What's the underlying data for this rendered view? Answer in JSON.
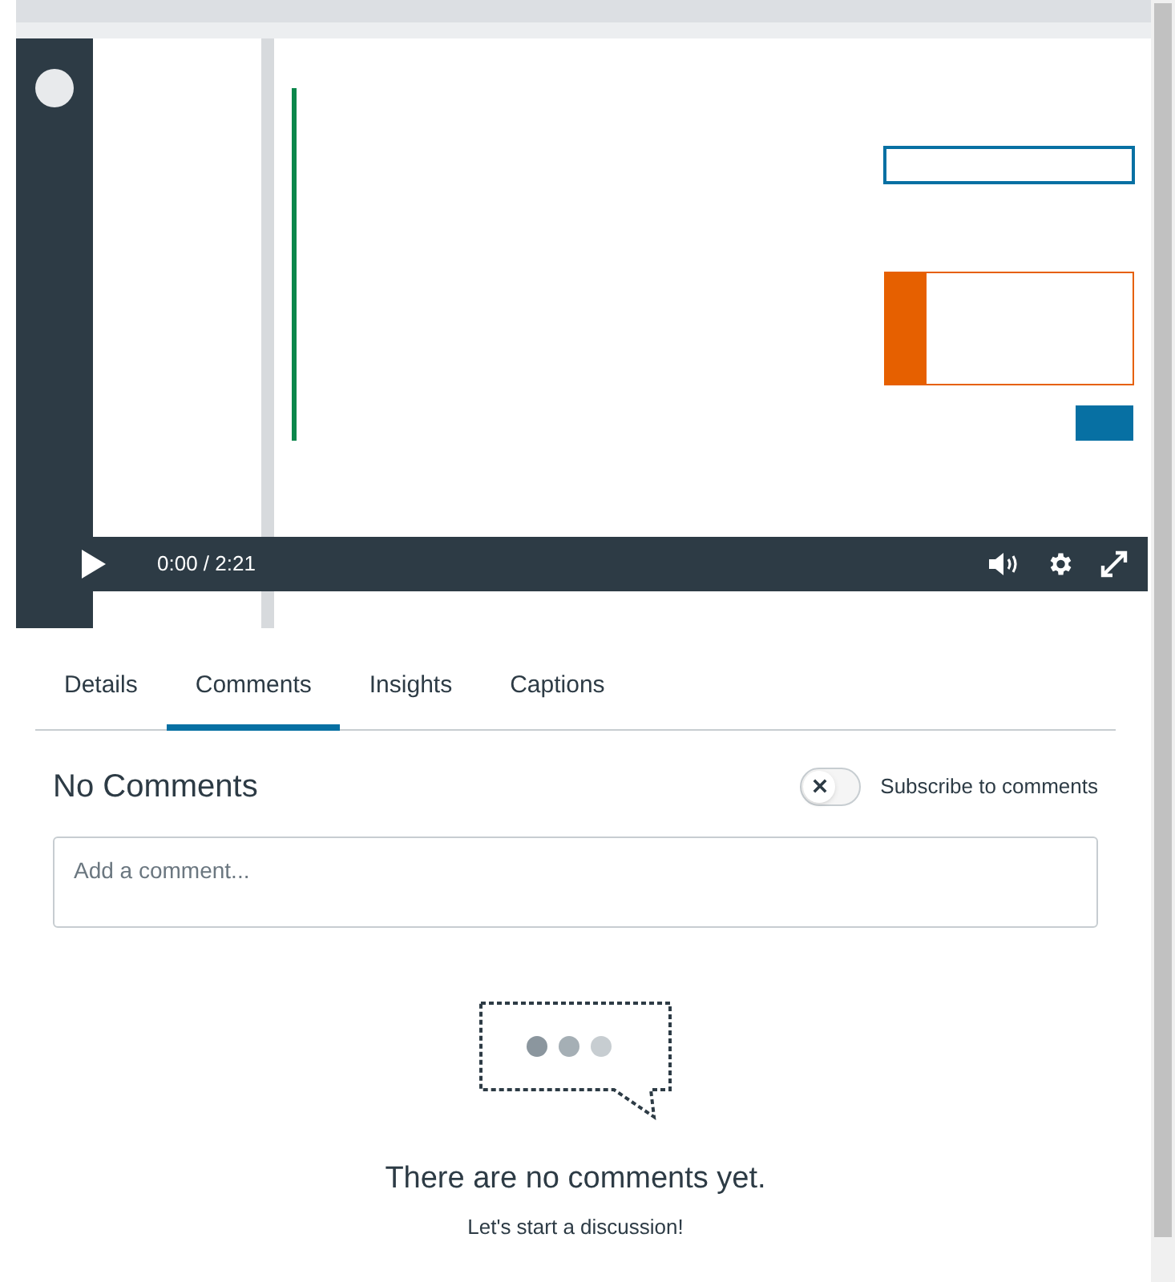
{
  "video": {
    "kind": "picture",
    "playing": false,
    "time": "0:00 / 2:21"
  },
  "tabs": [
    {
      "label": "Details",
      "selected": false
    },
    {
      "label": "Comments",
      "selected": true
    },
    {
      "label": "Insights",
      "selected": false
    },
    {
      "label": "Captions",
      "selected": false
    }
  ],
  "comments": {
    "title": "No Comments",
    "subscribe": {
      "label": "Subscribe to comments",
      "on": false
    },
    "input": {
      "placeholder": "Add a comment..."
    },
    "empty": {
      "title": "There are no comments yet.",
      "subtitle": "Let's start a discussion!"
    }
  }
}
